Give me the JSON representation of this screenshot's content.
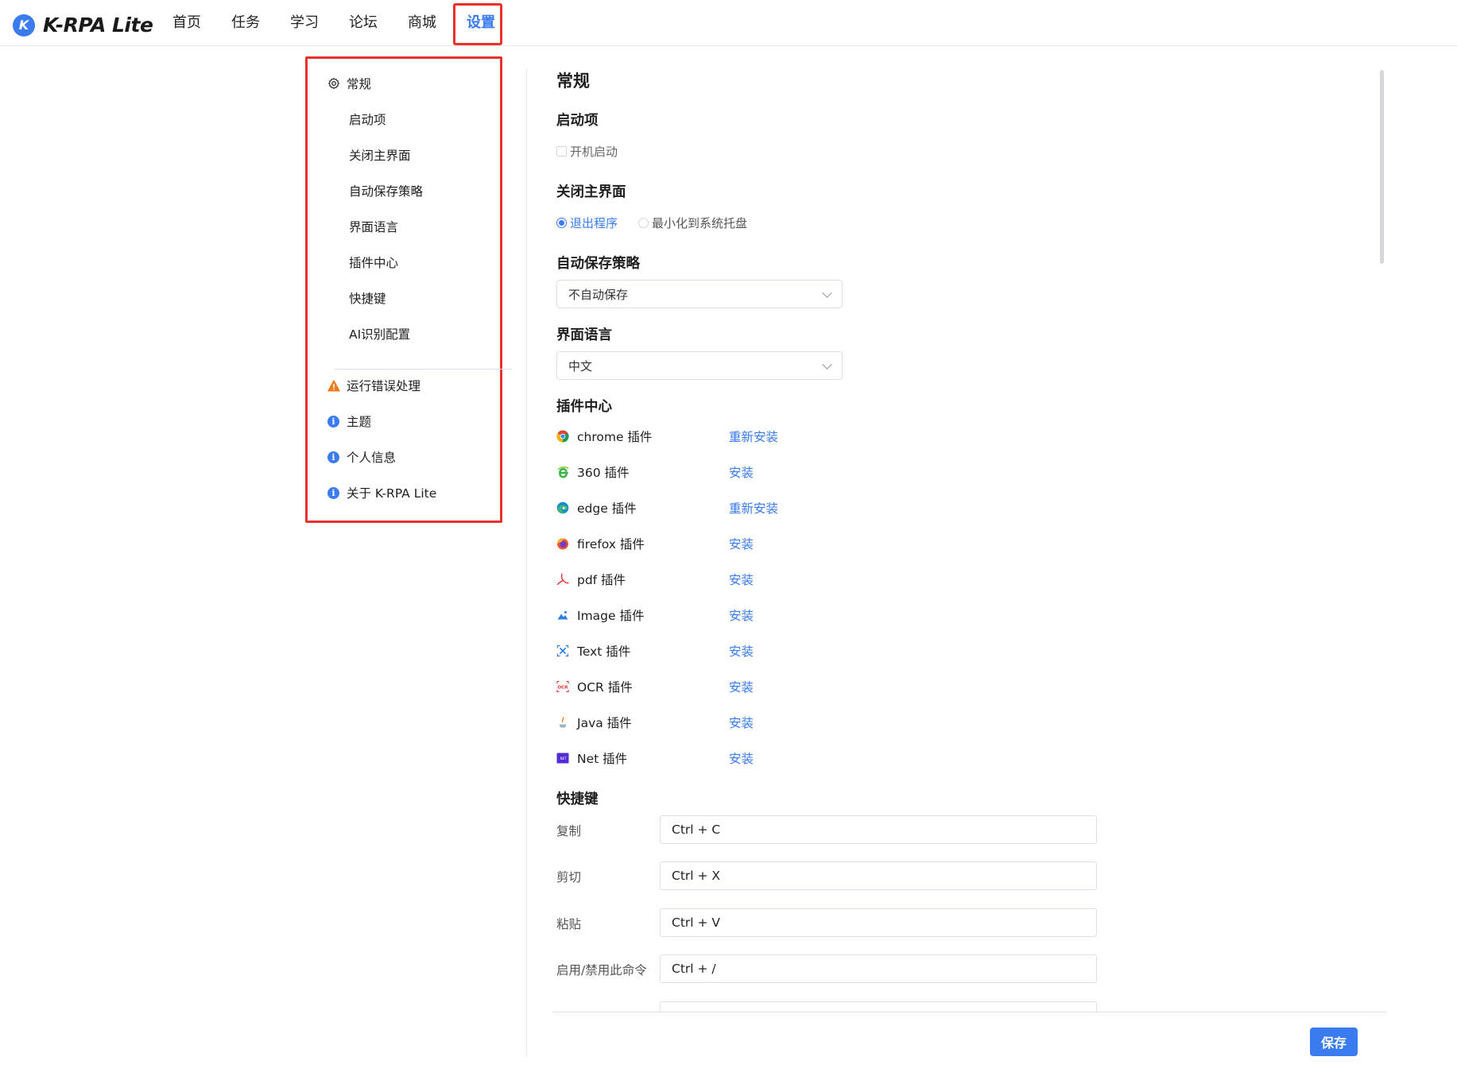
{
  "app": {
    "logo_letter": "K",
    "name": "K-RPA Lite"
  },
  "nav": {
    "items": [
      "首页",
      "任务",
      "学习",
      "论坛",
      "商城",
      "设置"
    ],
    "active_index": 5
  },
  "menu": {
    "general": "常规",
    "sub_items": [
      "启动项",
      "关闭主界面",
      "自动保存策略",
      "界面语言",
      "插件中心",
      "快捷键",
      "AI识别配置"
    ],
    "error_handling": "运行错误处理",
    "theme": "主题",
    "profile": "个人信息",
    "about": "关于 K-RPA Lite"
  },
  "content": {
    "title": "常规",
    "startup": {
      "title": "启动项",
      "checkbox_label": "开机启动",
      "checked": false
    },
    "close_main": {
      "title": "关闭主界面",
      "options": [
        "退出程序",
        "最小化到系统托盘"
      ],
      "selected_index": 0
    },
    "autosave": {
      "title": "自动保存策略",
      "value": "不自动保存"
    },
    "language": {
      "title": "界面语言",
      "value": "中文"
    },
    "plugins": {
      "title": "插件中心",
      "items": [
        {
          "name": "chrome 插件",
          "action": "重新安装",
          "icon": "chrome-icon"
        },
        {
          "name": "360 插件",
          "action": "安装",
          "icon": "360-browser-icon"
        },
        {
          "name": "edge 插件",
          "action": "重新安装",
          "icon": "edge-icon"
        },
        {
          "name": "firefox 插件",
          "action": "安装",
          "icon": "firefox-icon"
        },
        {
          "name": "pdf 插件",
          "action": "安装",
          "icon": "pdf-icon"
        },
        {
          "name": "Image 插件",
          "action": "安装",
          "icon": "image-icon"
        },
        {
          "name": "Text 插件",
          "action": "安装",
          "icon": "text-icon"
        },
        {
          "name": "OCR 插件",
          "action": "安装",
          "icon": "ocr-icon"
        },
        {
          "name": "Java 插件",
          "action": "安装",
          "icon": "java-icon"
        },
        {
          "name": "Net 插件",
          "action": "安装",
          "icon": "dotnet-icon"
        }
      ]
    },
    "hotkeys": {
      "title": "快捷键",
      "items": [
        {
          "label": "复制",
          "value": "Ctrl + C"
        },
        {
          "label": "剪切",
          "value": "Ctrl + X"
        },
        {
          "label": "粘贴",
          "value": "Ctrl + V"
        },
        {
          "label": "启用/禁用此命令",
          "value": "Ctrl + /"
        }
      ]
    }
  },
  "footer": {
    "save_label": "保存"
  },
  "colors": {
    "accent": "#3a7bf0",
    "highlight_box": "#e8302c",
    "warning": "#f07a18"
  }
}
